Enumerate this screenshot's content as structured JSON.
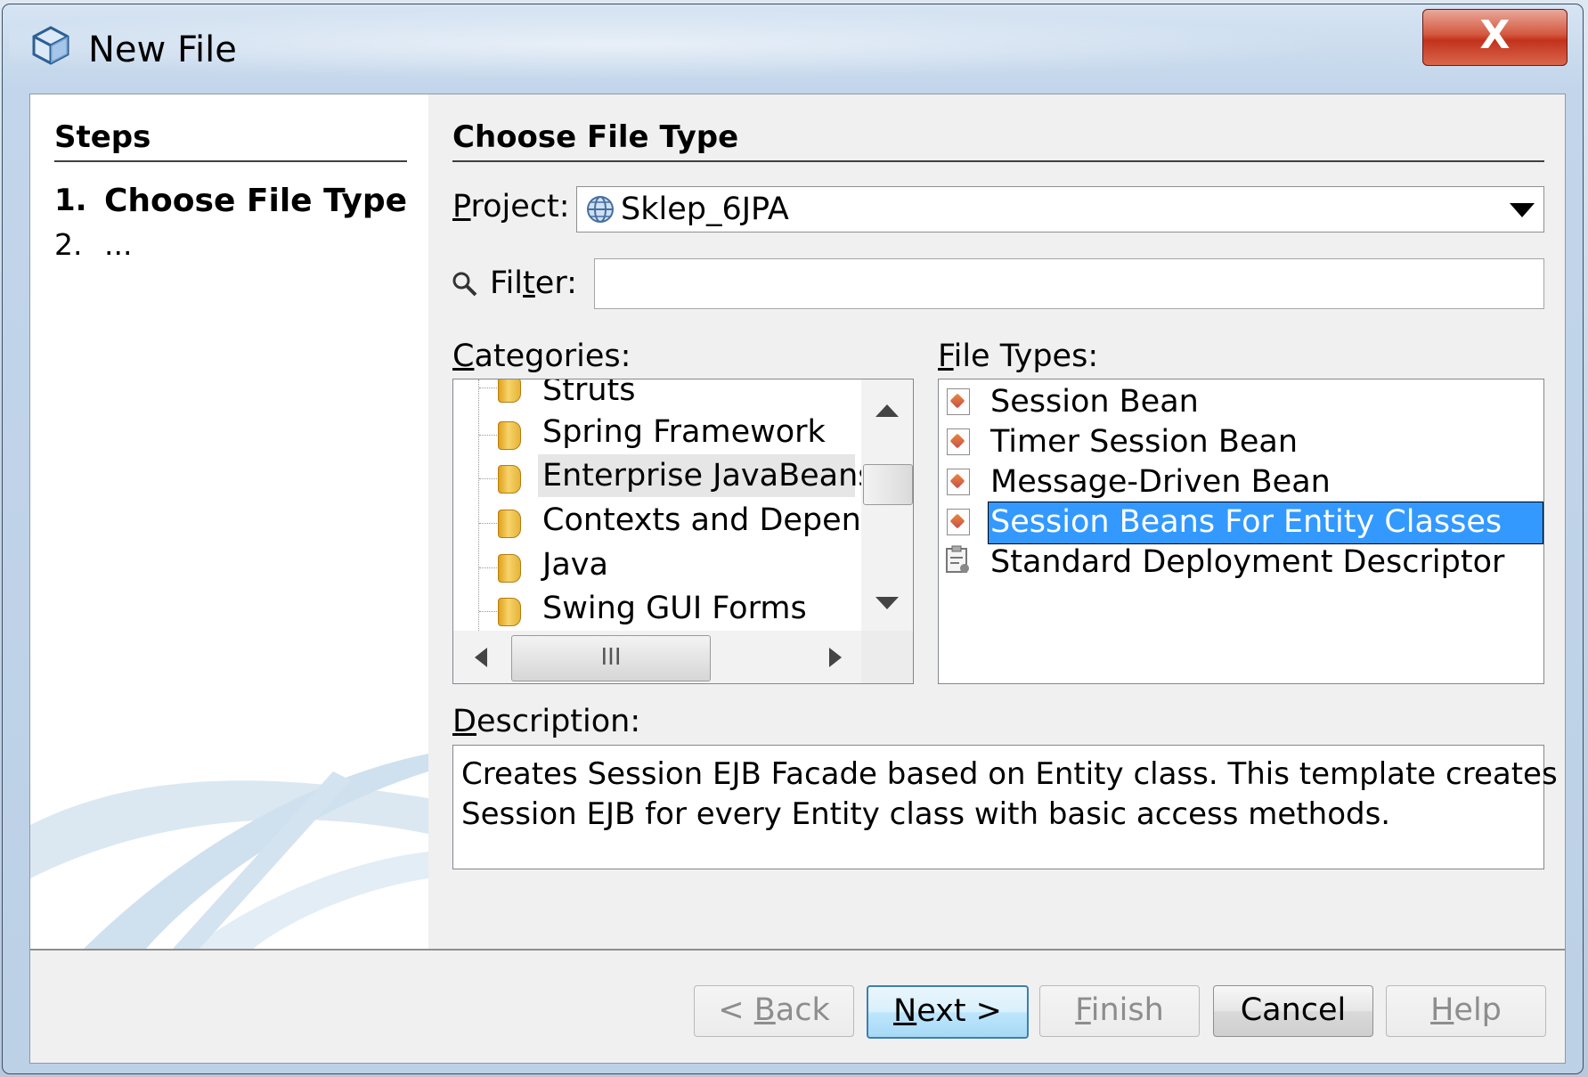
{
  "window": {
    "title": "New File",
    "close_label": "X"
  },
  "steps": {
    "heading": "Steps",
    "items": [
      {
        "number": "1.",
        "label": "Choose File Type"
      },
      {
        "number": "2.",
        "label": "..."
      }
    ]
  },
  "main": {
    "heading": "Choose File Type",
    "project": {
      "label": "Project:",
      "value": "Sklep_6JPA"
    },
    "filter": {
      "label": "Filter:",
      "value": ""
    },
    "categories": {
      "label": "Categories:",
      "items": [
        "Struts",
        "Spring Framework",
        "Enterprise JavaBeans",
        "Contexts and Depende",
        "Java",
        "Swing GUI Forms"
      ],
      "selected": "Enterprise JavaBeans",
      "hscroll_thumb": "III"
    },
    "file_types": {
      "label": "File Types:",
      "items": [
        "Session Bean",
        "Timer Session Bean",
        "Message-Driven Bean",
        "Session Beans For Entity Classes",
        "Standard Deployment Descriptor"
      ],
      "selected": "Session Beans For Entity Classes"
    },
    "description": {
      "label": "Description:",
      "line1": "Creates Session EJB Facade based on Entity class. This template creates",
      "line2": "Session EJB for every Entity class with basic access methods."
    }
  },
  "buttons": {
    "back": "< Back",
    "next": "Next >",
    "finish": "Finish",
    "cancel": "Cancel",
    "help": "Help"
  },
  "colors": {
    "selection": "#3399ff",
    "close_button": "#c7402a"
  }
}
